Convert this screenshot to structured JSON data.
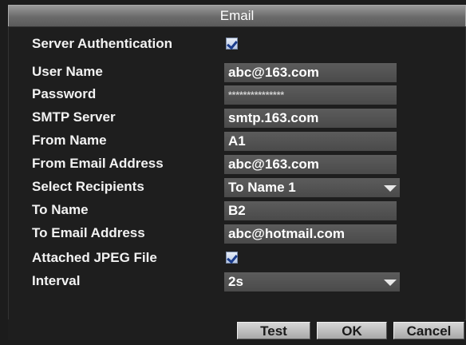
{
  "dialog": {
    "title": "Email"
  },
  "fields": {
    "server_authentication": {
      "label": "Server Authentication",
      "checked": true
    },
    "user_name": {
      "label": "User Name",
      "value": "abc@163.com"
    },
    "password": {
      "label": "Password",
      "value": "***************"
    },
    "smtp_server": {
      "label": "SMTP Server",
      "value": "smtp.163.com"
    },
    "from_name": {
      "label": "From Name",
      "value": "A1"
    },
    "from_email": {
      "label": "From Email Address",
      "value": "abc@163.com"
    },
    "select_recipients": {
      "label": "Select Recipients",
      "value": "To Name 1"
    },
    "to_name": {
      "label": "To Name",
      "value": "B2"
    },
    "to_email": {
      "label": "To Email Address",
      "value": "abc@hotmail.com"
    },
    "attached_jpeg": {
      "label": "Attached JPEG File",
      "checked": true
    },
    "interval": {
      "label": "Interval",
      "value": "2s"
    }
  },
  "buttons": {
    "test": "Test",
    "ok": "OK",
    "cancel": "Cancel"
  },
  "icons": {
    "checkbox": "checkmark-icon",
    "dropdown": "dropdown-arrow-icon"
  }
}
